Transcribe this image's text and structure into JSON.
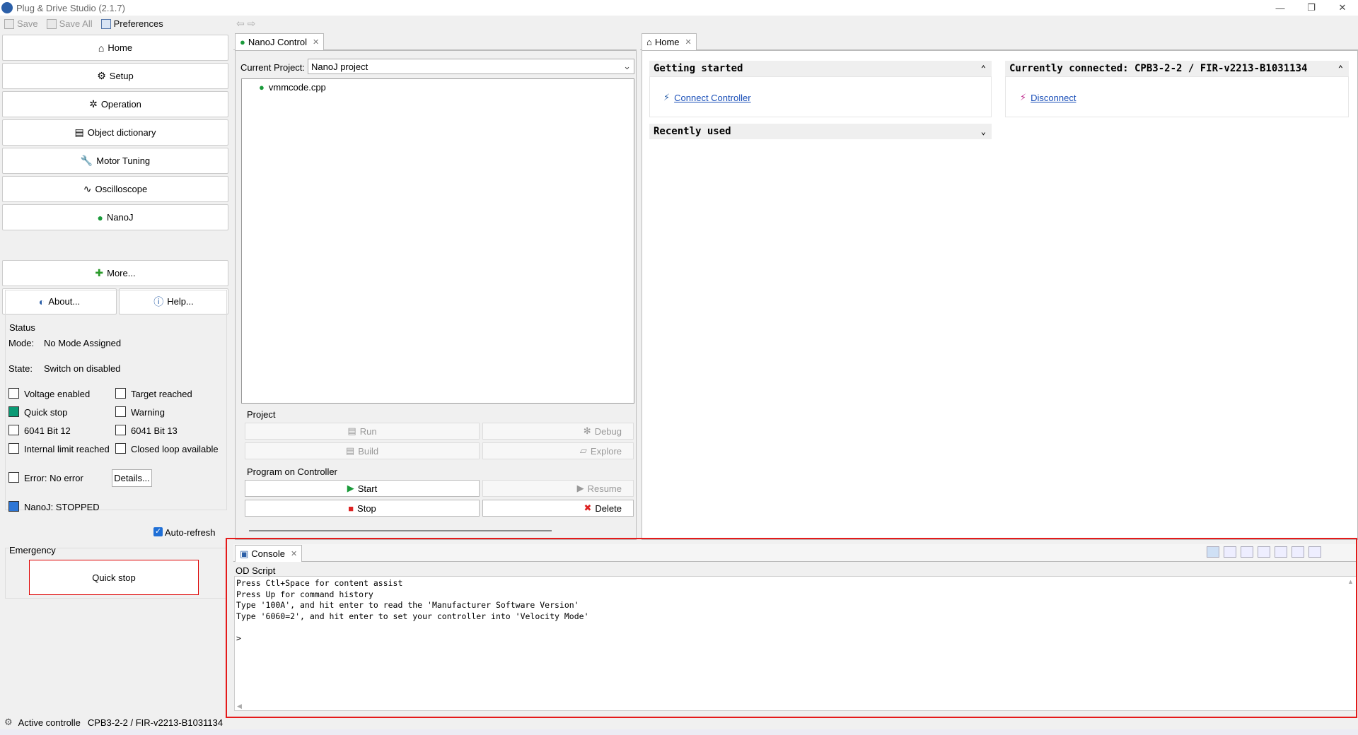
{
  "window": {
    "title": "Plug & Drive Studio (2.1.7)",
    "controls": [
      "—",
      "❐",
      "✕"
    ]
  },
  "toolbar": {
    "save": "Save",
    "save_all": "Save All",
    "preferences": "Preferences"
  },
  "nav": {
    "home": "Home",
    "setup": "Setup",
    "operation": "Operation",
    "object_dictionary": "Object dictionary",
    "motor_tuning": "Motor Tuning",
    "oscilloscope": "Oscilloscope",
    "nanoj": "NanoJ",
    "more": "More...",
    "about": "About...",
    "help": "Help..."
  },
  "status": {
    "group_title": "Status",
    "mode_label": "Mode:",
    "mode_value": "No Mode Assigned",
    "state_label": "State:",
    "state_value": "Switch on disabled",
    "voltage_enabled": "Voltage enabled",
    "target_reached": "Target reached",
    "quick_stop": "Quick stop",
    "warning": "Warning",
    "bit12": "6041 Bit 12",
    "bit13": "6041 Bit 13",
    "internal_limit": "Internal limit reached",
    "closed_loop": "Closed loop available",
    "error": "Error:  No error",
    "details": "Details...",
    "nanoj": "NanoJ:  STOPPED",
    "auto_refresh": "Auto-refresh"
  },
  "emergency": {
    "title": "Emergency",
    "quick_stop": "Quick stop"
  },
  "nanoj_control": {
    "tab": "NanoJ Control",
    "current_project_label": "Current Project:",
    "current_project_value": "NanoJ project",
    "file": "vmmcode.cpp",
    "project_group": "Project",
    "run": "Run",
    "debug": "Debug",
    "build": "Build",
    "explore": "Explore",
    "program_group": "Program on Controller",
    "start": "Start",
    "resume": "Resume",
    "stop": "Stop",
    "delete": "Delete"
  },
  "home": {
    "tab": "Home",
    "getting_started": "Getting started",
    "connect_controller": "Connect Controller",
    "recently_used": "Recently used",
    "currently_connected": "Currently connected: CPB3-2-2 / FIR-v2213-B1031134",
    "disconnect": "Disconnect"
  },
  "console": {
    "tab": "Console",
    "mode": "OD Script",
    "lines": "Press Ctl+Space for content assist\nPress Up for command history\nType '100A', and hit enter to read the 'Manufacturer Software Version'\nType '6060=2', and hit enter to set your controller into 'Velocity Mode'\n\n>"
  },
  "statusbar": {
    "label": "Active controlle",
    "value": "CPB3-2-2 / FIR-v2213-B1031134"
  }
}
